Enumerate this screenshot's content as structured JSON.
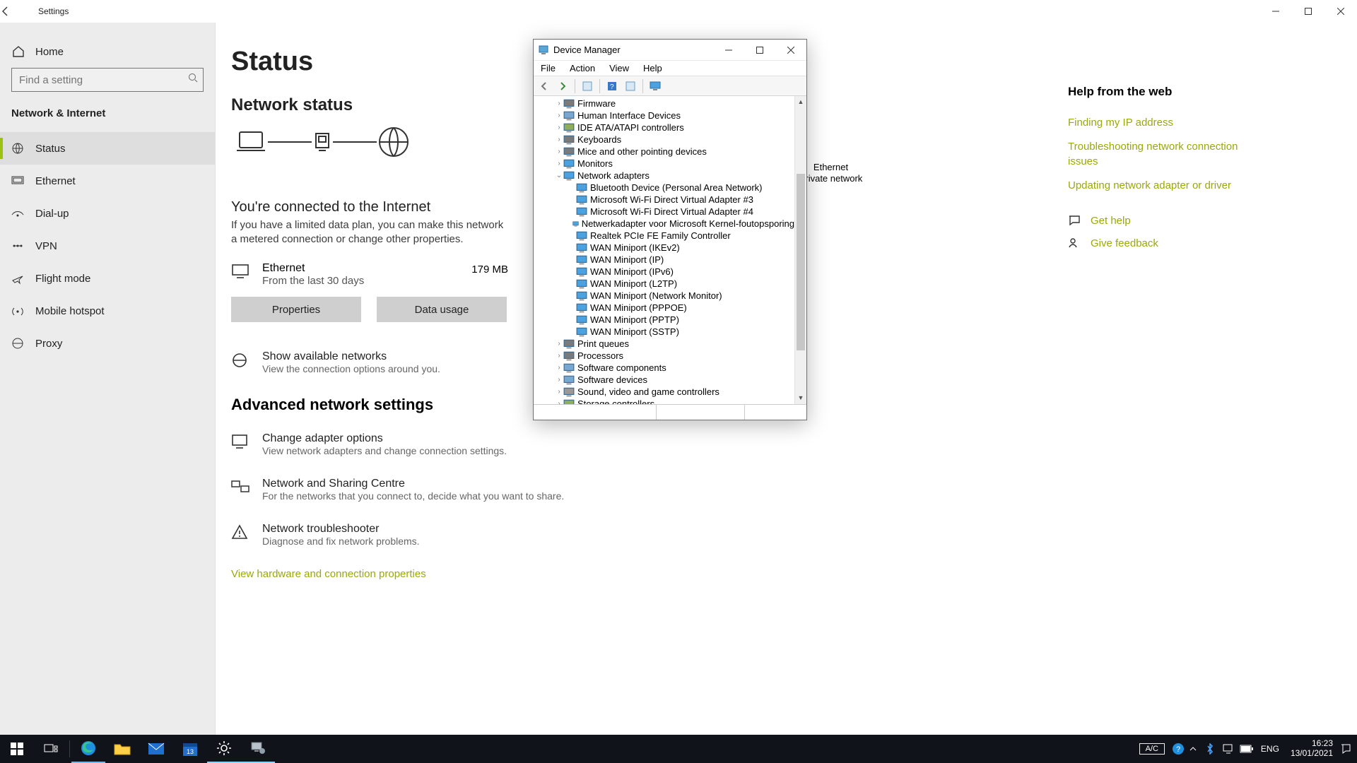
{
  "settings": {
    "titlebar": {
      "title": "Settings"
    },
    "home_label": "Home",
    "search_placeholder": "Find a setting",
    "section_heading": "Network & Internet",
    "nav": [
      {
        "label": "Status"
      },
      {
        "label": "Ethernet"
      },
      {
        "label": "Dial-up"
      },
      {
        "label": "VPN"
      },
      {
        "label": "Flight mode"
      },
      {
        "label": "Mobile hotspot"
      },
      {
        "label": "Proxy"
      }
    ],
    "page": {
      "title": "Status",
      "subhead": "Network status",
      "diagram_label_top": "Ethernet",
      "diagram_label_bottom": "Private network",
      "connected_heading": "You're connected to the Internet",
      "connected_desc": "If you have a limited data plan, you can make this network a metered connection or change other properties.",
      "eth_name": "Ethernet",
      "eth_sub": "From the last 30 days",
      "eth_usage": "179 MB",
      "btn_properties": "Properties",
      "btn_datausage": "Data usage",
      "show_networks_t": "Show available networks",
      "show_networks_s": "View the connection options around you.",
      "adv_heading": "Advanced network settings",
      "adapter_t": "Change adapter options",
      "adapter_s": "View network adapters and change connection settings.",
      "sharing_t": "Network and Sharing Centre",
      "sharing_s": "For the networks that you connect to, decide what you want to share.",
      "troubleshoot_t": "Network troubleshooter",
      "troubleshoot_s": "Diagnose and fix network problems.",
      "view_hw_link": "View hardware and connection properties"
    },
    "help": {
      "heading": "Help from the web",
      "links": [
        "Finding my IP address",
        "Troubleshooting network connection issues",
        "Updating network adapter or driver"
      ],
      "get_help": "Get help",
      "give_feedback": "Give feedback"
    }
  },
  "devmgr": {
    "title": "Device Manager",
    "menus": [
      "File",
      "Action",
      "View",
      "Help"
    ],
    "tree": [
      {
        "d": 1,
        "exp": ">",
        "label": "Firmware",
        "icon": "chip"
      },
      {
        "d": 1,
        "exp": ">",
        "label": "Human Interface Devices",
        "icon": "hid"
      },
      {
        "d": 1,
        "exp": ">",
        "label": "IDE ATA/ATAPI controllers",
        "icon": "ide"
      },
      {
        "d": 1,
        "exp": ">",
        "label": "Keyboards",
        "icon": "kbd"
      },
      {
        "d": 1,
        "exp": ">",
        "label": "Mice and other pointing devices",
        "icon": "mouse"
      },
      {
        "d": 1,
        "exp": ">",
        "label": "Monitors",
        "icon": "mon"
      },
      {
        "d": 1,
        "exp": "v",
        "label": "Network adapters",
        "icon": "net"
      },
      {
        "d": 2,
        "exp": "",
        "label": "Bluetooth Device (Personal Area Network)",
        "icon": "net"
      },
      {
        "d": 2,
        "exp": "",
        "label": "Microsoft Wi-Fi Direct Virtual Adapter #3",
        "icon": "net"
      },
      {
        "d": 2,
        "exp": "",
        "label": "Microsoft Wi-Fi Direct Virtual Adapter #4",
        "icon": "net"
      },
      {
        "d": 2,
        "exp": "",
        "label": "Netwerkadapter voor Microsoft Kernel-foutopsporing",
        "icon": "net"
      },
      {
        "d": 2,
        "exp": "",
        "label": "Realtek PCIe FE Family Controller",
        "icon": "net"
      },
      {
        "d": 2,
        "exp": "",
        "label": "WAN Miniport (IKEv2)",
        "icon": "net"
      },
      {
        "d": 2,
        "exp": "",
        "label": "WAN Miniport (IP)",
        "icon": "net"
      },
      {
        "d": 2,
        "exp": "",
        "label": "WAN Miniport (IPv6)",
        "icon": "net"
      },
      {
        "d": 2,
        "exp": "",
        "label": "WAN Miniport (L2TP)",
        "icon": "net"
      },
      {
        "d": 2,
        "exp": "",
        "label": "WAN Miniport (Network Monitor)",
        "icon": "net"
      },
      {
        "d": 2,
        "exp": "",
        "label": "WAN Miniport (PPPOE)",
        "icon": "net"
      },
      {
        "d": 2,
        "exp": "",
        "label": "WAN Miniport (PPTP)",
        "icon": "net"
      },
      {
        "d": 2,
        "exp": "",
        "label": "WAN Miniport (SSTP)",
        "icon": "net"
      },
      {
        "d": 1,
        "exp": ">",
        "label": "Print queues",
        "icon": "print"
      },
      {
        "d": 1,
        "exp": ">",
        "label": "Processors",
        "icon": "cpu"
      },
      {
        "d": 1,
        "exp": ">",
        "label": "Software components",
        "icon": "sw"
      },
      {
        "d": 1,
        "exp": ">",
        "label": "Software devices",
        "icon": "sw"
      },
      {
        "d": 1,
        "exp": ">",
        "label": "Sound, video and game controllers",
        "icon": "snd"
      },
      {
        "d": 1,
        "exp": ">",
        "label": "Storage controllers",
        "icon": "stor"
      }
    ]
  },
  "taskbar": {
    "chip": "A/C",
    "lang": "ENG",
    "time": "16:23",
    "date": "13/01/2021"
  }
}
